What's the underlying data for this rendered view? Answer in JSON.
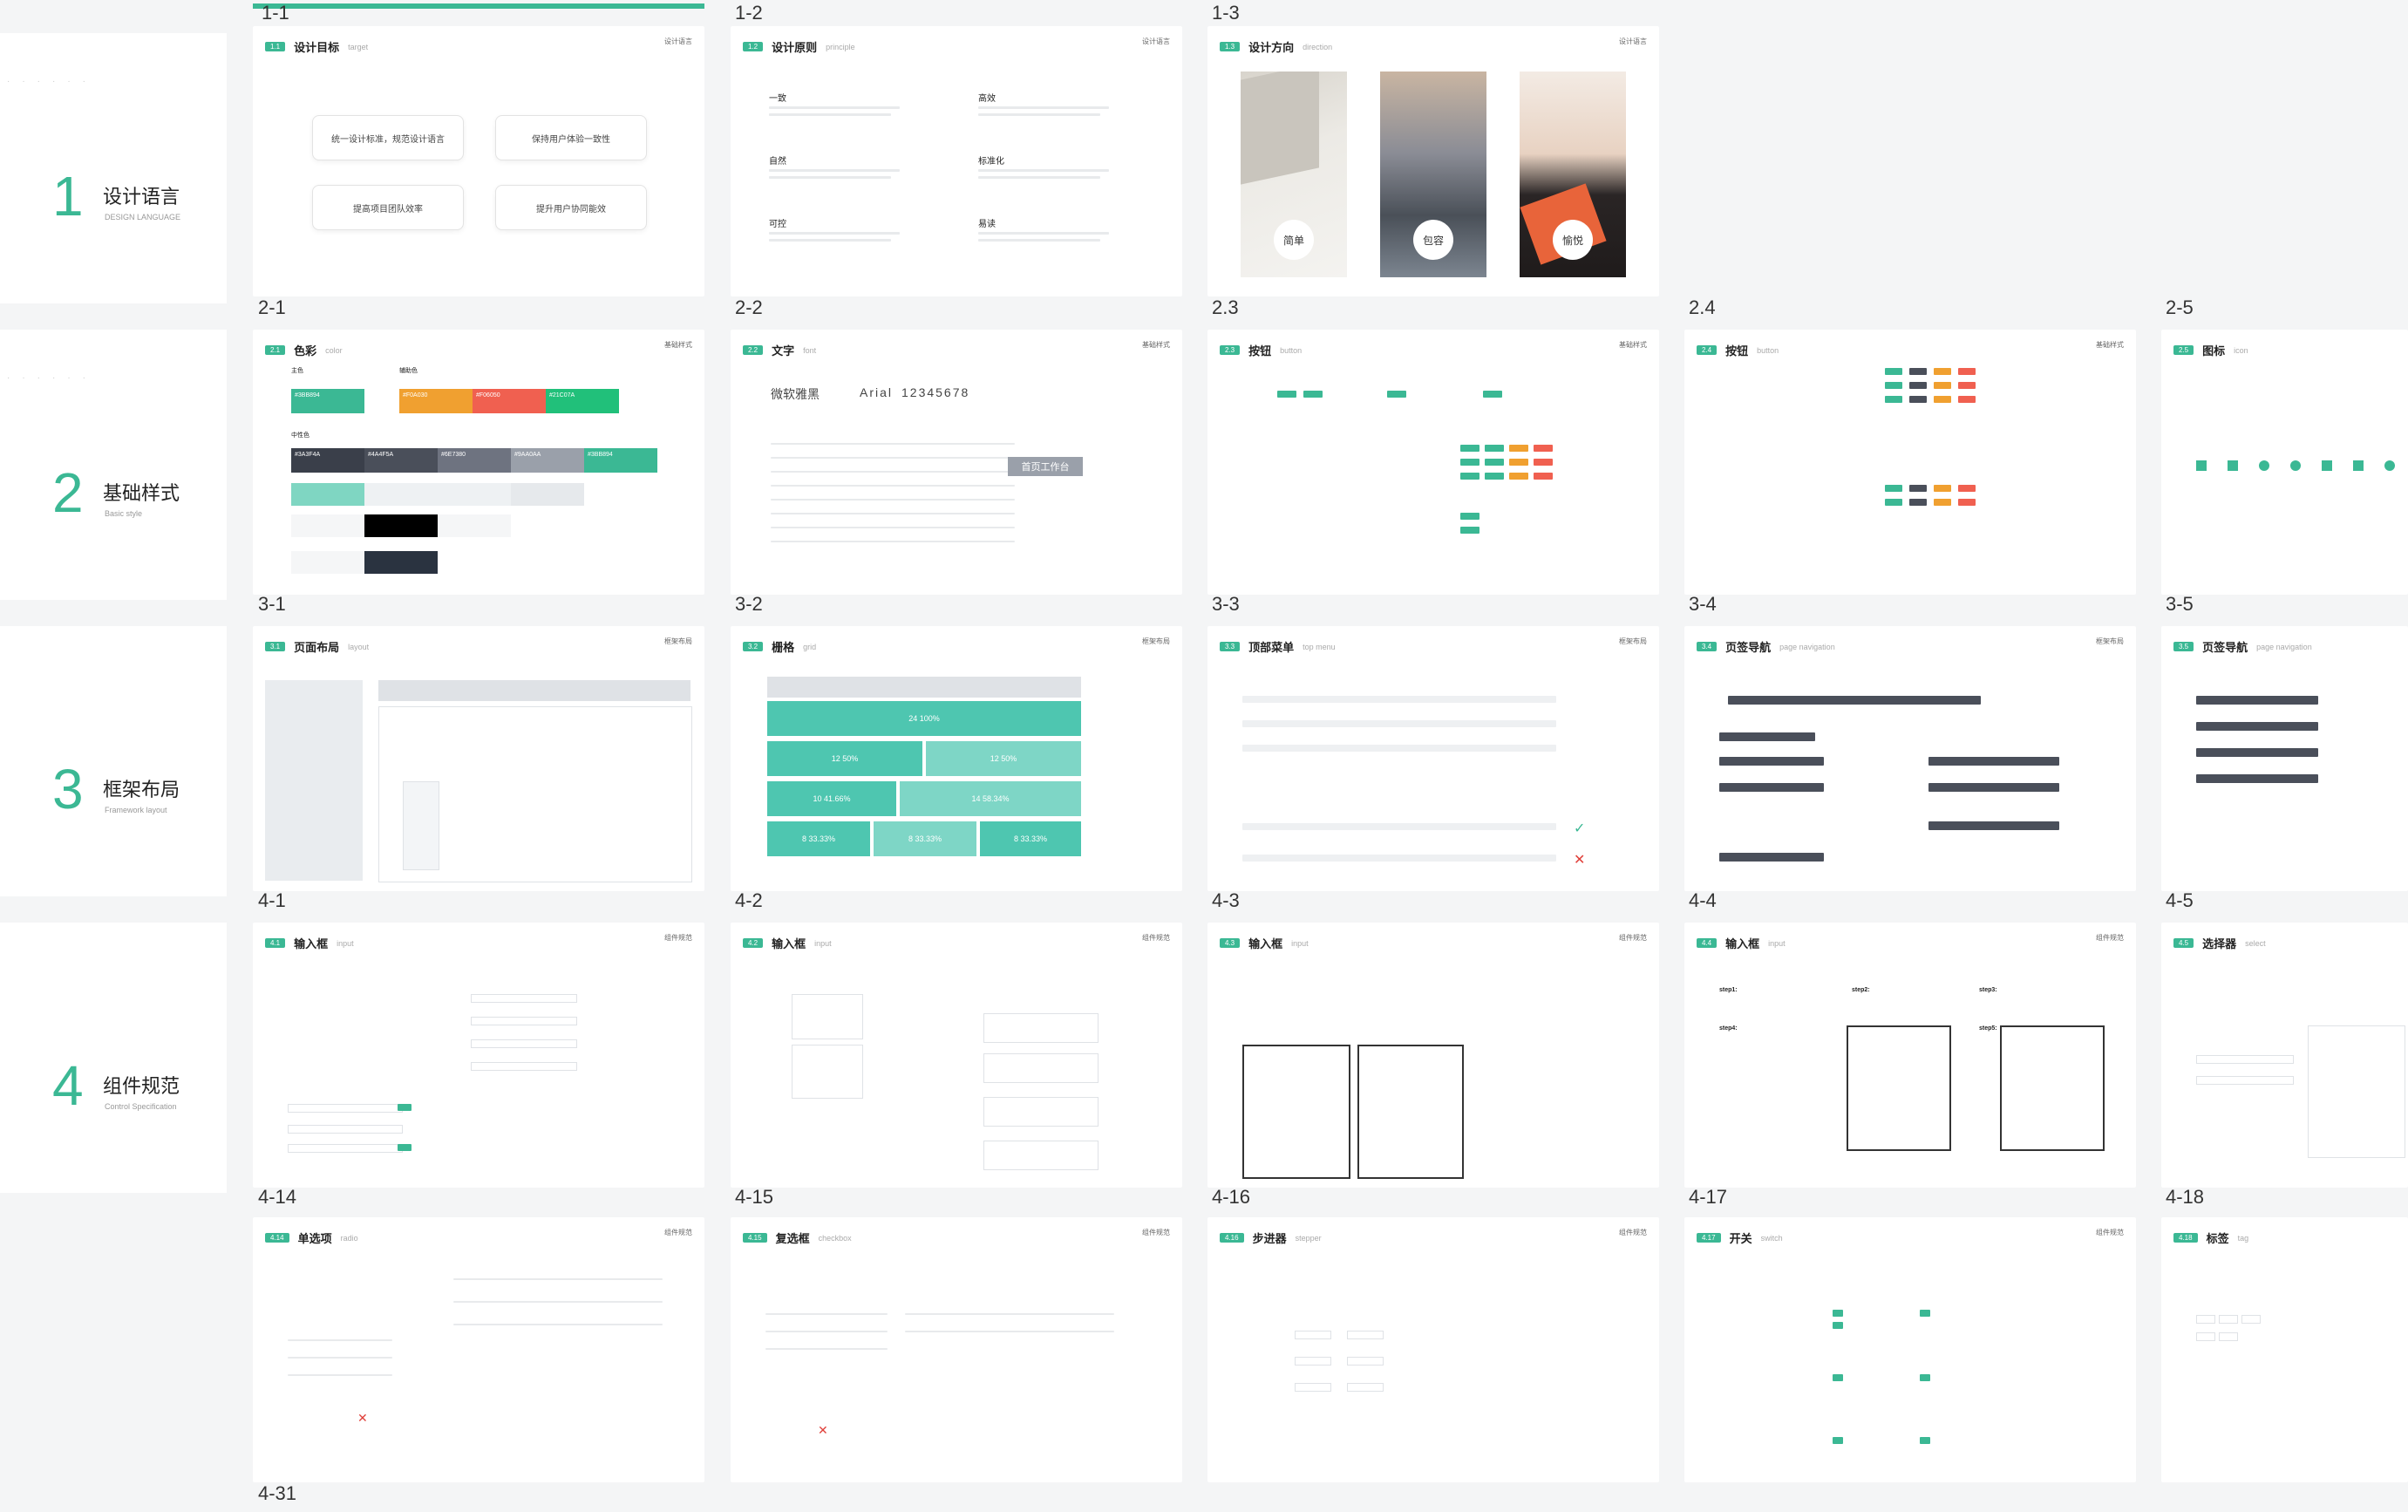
{
  "colors": {
    "accent": "#3bb894",
    "text": "#222222",
    "muted": "#999999",
    "dark": "#3a3f4a",
    "orange": "#f0a030",
    "red": "#f06050"
  },
  "sections": [
    {
      "num": "1",
      "zh": "设计语言",
      "en": "DESIGN LANGUAGE"
    },
    {
      "num": "2",
      "zh": "基础样式",
      "en": "Basic style"
    },
    {
      "num": "3",
      "zh": "框架布局",
      "en": "Framework layout"
    },
    {
      "num": "4",
      "zh": "组件规范",
      "en": "Control Specification"
    }
  ],
  "frame_labels": [
    "1-1",
    "1-2",
    "1-3",
    "2-1",
    "2-2",
    "2.3",
    "2.4",
    "2-5",
    "3-1",
    "3-2",
    "3-3",
    "3-4",
    "3-5",
    "4-1",
    "4-2",
    "4-3",
    "4-4",
    "4-5",
    "4-14",
    "4-15",
    "4-16",
    "4-17",
    "4-18",
    "4-31"
  ],
  "boards": {
    "b11": {
      "num": "1.1",
      "title": "设计目标",
      "sub": "target",
      "tag": "设计语言",
      "pills": [
        "统一设计标准，规范设计语言",
        "保持用户体验一致性",
        "提高项目团队效率",
        "提升用户协同能效"
      ]
    },
    "b12": {
      "num": "1.2",
      "title": "设计原则",
      "sub": "principle",
      "tag": "设计语言",
      "items": [
        "一致",
        "高效",
        "自然",
        "标准化",
        "可控",
        "易读"
      ]
    },
    "b13": {
      "num": "1.3",
      "title": "设计方向",
      "sub": "direction",
      "tag": "设计语言",
      "words": [
        "简单",
        "包容",
        "愉悦"
      ]
    },
    "b21": {
      "num": "2.1",
      "title": "色彩",
      "sub": "color",
      "tag": "基础样式",
      "groups": [
        "主色",
        "辅助色",
        "中性色"
      ],
      "main": [
        {
          "hex": "#3bb894",
          "label": "#3BB894"
        }
      ],
      "aux": [
        {
          "hex": "#f0a030",
          "label": "#F0A030"
        },
        {
          "hex": "#f06050",
          "label": "#F06050"
        },
        {
          "hex": "#21c07a",
          "label": "#21C07A"
        }
      ],
      "neutral": [
        {
          "hex": "#3a3f4a",
          "label": "#3A3F4A"
        },
        {
          "hex": "#4a4f5a",
          "label": "#4A4F5A"
        },
        {
          "hex": "#6e7380",
          "label": "#6E7380"
        },
        {
          "hex": "#9aa0aa",
          "label": "#9AA0AA"
        },
        {
          "hex": "#c7cbd1",
          "label": "#C7CBD1"
        },
        {
          "hex": "#3bb894",
          "label": "#3BB894"
        }
      ]
    },
    "b22": {
      "num": "2.2",
      "title": "文字",
      "sub": "font",
      "tag": "基础样式",
      "font_cn": "微软雅黑",
      "font_en": "Arial",
      "digits": "12345678",
      "workbench": "首页工作台"
    },
    "b23": {
      "num": "2.3",
      "title": "按钮",
      "sub": "button",
      "tag": "基础样式"
    },
    "b24": {
      "num": "2.4",
      "title": "按钮",
      "sub": "button",
      "tag": "基础样式"
    },
    "b25": {
      "num": "2.5",
      "title": "图标",
      "sub": "icon",
      "tag": "基础样式"
    },
    "b31": {
      "num": "3.1",
      "title": "页面布局",
      "sub": "layout",
      "tag": "框架布局"
    },
    "b32": {
      "num": "3.2",
      "title": "栅格",
      "sub": "grid",
      "tag": "框架布局",
      "rows": [
        [
          "24 100%"
        ],
        [
          "12 50%",
          "12 50%"
        ],
        [
          "10 41.66%",
          "14 58.34%"
        ],
        [
          "8 33.33%",
          "8 33.33%",
          "8 33.33%"
        ]
      ]
    },
    "b33": {
      "num": "3.3",
      "title": "顶部菜单",
      "sub": "top menu",
      "tag": "框架布局"
    },
    "b34": {
      "num": "3.4",
      "title": "页签导航",
      "sub": "page navigation",
      "tag": "框架布局"
    },
    "b35": {
      "num": "3.5",
      "title": "页签导航",
      "sub": "page navigation",
      "tag": "框架布局"
    },
    "b41": {
      "num": "4.1",
      "title": "输入框",
      "sub": "input",
      "tag": "组件规范"
    },
    "b42": {
      "num": "4.2",
      "title": "输入框",
      "sub": "input",
      "tag": "组件规范"
    },
    "b43": {
      "num": "4.3",
      "title": "输入框",
      "sub": "input",
      "tag": "组件规范"
    },
    "b44": {
      "num": "4.4",
      "title": "输入框",
      "sub": "input",
      "tag": "组件规范",
      "steps": [
        "step1:",
        "step2:",
        "step3:",
        "step4:",
        "step5:"
      ]
    },
    "b45": {
      "num": "4.5",
      "title": "选择器",
      "sub": "select",
      "tag": "组件规范"
    },
    "b414": {
      "num": "4.14",
      "title": "单选项",
      "sub": "radio",
      "tag": "组件规范"
    },
    "b415": {
      "num": "4.15",
      "title": "复选框",
      "sub": "checkbox",
      "tag": "组件规范"
    },
    "b416": {
      "num": "4.16",
      "title": "步进器",
      "sub": "stepper",
      "tag": "组件规范"
    },
    "b417": {
      "num": "4.17",
      "title": "开关",
      "sub": "switch",
      "tag": "组件规范"
    },
    "b418": {
      "num": "4.18",
      "title": "标签",
      "sub": "tag",
      "tag": "组件规范"
    }
  }
}
